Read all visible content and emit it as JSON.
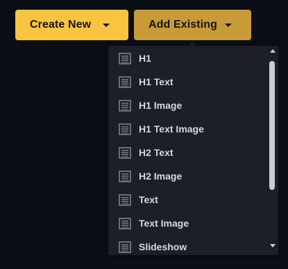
{
  "buttons": {
    "create_new": {
      "label": "Create New"
    },
    "add_existing": {
      "label": "Add Existing"
    }
  },
  "dropdown": {
    "items": [
      {
        "label": "H1",
        "icon": "document-lines-icon"
      },
      {
        "label": "H1 Text",
        "icon": "document-lines-icon"
      },
      {
        "label": "H1 Image",
        "icon": "document-lines-icon"
      },
      {
        "label": "H1 Text Image",
        "icon": "document-lines-icon"
      },
      {
        "label": "H2 Text",
        "icon": "document-lines-icon"
      },
      {
        "label": "H2 Image",
        "icon": "document-lines-icon"
      },
      {
        "label": "Text",
        "icon": "document-lines-icon"
      },
      {
        "label": "Text Image",
        "icon": "document-lines-icon"
      },
      {
        "label": "Slideshow",
        "icon": "document-lines-icon"
      }
    ]
  },
  "colors": {
    "background": "#0b0e15",
    "primary_button": "#f9c440",
    "secondary_button": "#c89b36",
    "menu_background": "#1b1f27",
    "menu_text": "#d6d9e0"
  }
}
